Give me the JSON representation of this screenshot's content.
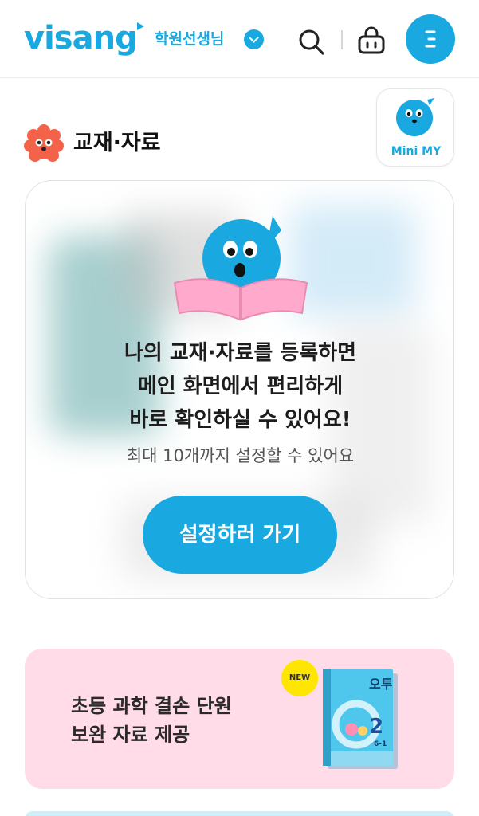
{
  "header": {
    "logo_text": "visang",
    "role_label": "학원선생님",
    "icons": [
      "search-icon",
      "cart-icon",
      "menu-icon"
    ]
  },
  "section": {
    "title": "교재·자료"
  },
  "mini_my": {
    "label": "Mini MY"
  },
  "card": {
    "lines": [
      "나의 교재·자료를 등록하면",
      "메인 화면에서 편리하게",
      "바로 확인하실 수 있어요!"
    ],
    "sub": "최대 10개까지 설정할 수 있어요",
    "button_label": "설정하러 가기"
  },
  "banner": {
    "lines": [
      "초등 과학 결손 단원",
      "보완 자료 제공"
    ],
    "badge": "NEW",
    "book_title": "오투",
    "book_number": "2",
    "book_grade": "6-1"
  },
  "colors": {
    "brand": "#19a9e0",
    "banner_bg": "#ffdce8",
    "badge": "#ffe600",
    "book_cover": "#4fc6ec"
  }
}
